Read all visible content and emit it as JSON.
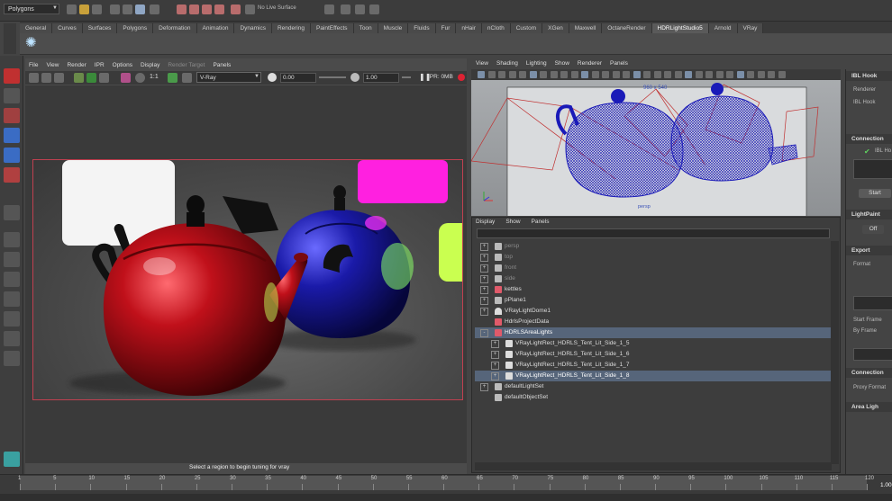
{
  "header": {
    "mode": "Polygons",
    "live_surface": "No Live Surface"
  },
  "shelf": {
    "tabs": [
      "General",
      "Curves",
      "Surfaces",
      "Polygons",
      "Deformation",
      "Animation",
      "Dynamics",
      "Rendering",
      "PaintEffects",
      "Toon",
      "Muscle",
      "Fluids",
      "Fur",
      "nHair",
      "nCloth",
      "Custom",
      "XGen",
      "Maxwell",
      "OctaneRender",
      "HDRLightStudio5",
      "Arnold",
      "VRay"
    ],
    "active_tab": "HDRLightStudio5"
  },
  "render_view": {
    "menu": [
      "File",
      "View",
      "Render",
      "IPR",
      "Options",
      "Display",
      "Render Target",
      "Panels"
    ],
    "renderer": "V-Ray",
    "exposure": "0.00",
    "gamma": "1.00",
    "ratio": "1:1",
    "ipr": "IPR: 0MB",
    "status": "Select a region to begin tuning for vray"
  },
  "viewport": {
    "menu": [
      "View",
      "Shading",
      "Lighting",
      "Show",
      "Renderer",
      "Panels"
    ],
    "resolution": "960 x 540",
    "camera": "persp"
  },
  "outliner": {
    "menu": [
      "Display",
      "Show",
      "Panels"
    ],
    "items": [
      {
        "label": "persp",
        "expand": "+",
        "depth": 0,
        "dim": true,
        "icon": "camera"
      },
      {
        "label": "top",
        "expand": "+",
        "depth": 0,
        "dim": true,
        "icon": "camera"
      },
      {
        "label": "front",
        "expand": "+",
        "depth": 0,
        "dim": true,
        "icon": "camera"
      },
      {
        "label": "side",
        "expand": "+",
        "depth": 0,
        "dim": true,
        "icon": "camera"
      },
      {
        "label": "kettles",
        "expand": "+",
        "depth": 0,
        "dim": false,
        "icon": "mesh"
      },
      {
        "label": "pPlane1",
        "expand": "+",
        "depth": 0,
        "dim": false,
        "icon": "plane"
      },
      {
        "label": "VRayLightDome1",
        "expand": "+",
        "depth": 0,
        "dim": false,
        "icon": "dome"
      },
      {
        "label": "HdrlsProjectData",
        "expand": "",
        "depth": 0,
        "dim": false,
        "icon": "mesh"
      },
      {
        "label": "HDRLSAreaLights",
        "expand": "-",
        "depth": 0,
        "dim": false,
        "icon": "mesh",
        "selected": true
      },
      {
        "label": "VRayLightRect_HDRLS_Tent_Lit_Side_1_5",
        "expand": "+",
        "depth": 1,
        "dim": false,
        "icon": "light"
      },
      {
        "label": "VRayLightRect_HDRLS_Tent_Lit_Side_1_6",
        "expand": "+",
        "depth": 1,
        "dim": false,
        "icon": "light"
      },
      {
        "label": "VRayLightRect_HDRLS_Tent_Lit_Side_1_7",
        "expand": "+",
        "depth": 1,
        "dim": false,
        "icon": "light"
      },
      {
        "label": "VRayLightRect_HDRLS_Tent_Lit_Side_1_8",
        "expand": "+",
        "depth": 1,
        "dim": false,
        "icon": "light",
        "selected": true
      },
      {
        "label": "defaultLightSet",
        "expand": "+",
        "depth": 0,
        "dim": false,
        "icon": "set"
      },
      {
        "label": "defaultObjectSet",
        "expand": "",
        "depth": 0,
        "dim": false,
        "icon": "set"
      }
    ]
  },
  "ibl_panel": {
    "title": "IBL Hook",
    "renderer_label": "Renderer",
    "hook_label": "IBL Hook",
    "connection_header": "Connection",
    "connection_item": "IBL Ho",
    "start_button": "Start",
    "lightpaint_header": "LightPaint",
    "off_button": "Off",
    "export_header": "Export",
    "format_label": "Format",
    "start_frame_label": "Start Frame",
    "by_frame_label": "By Frame",
    "connection2_header": "Connection",
    "proxy_format_label": "Proxy Format",
    "area_light_header": "Area Ligh"
  },
  "timeline": {
    "ticks": [
      "1",
      "5",
      "10",
      "15",
      "20",
      "25",
      "30",
      "35",
      "40",
      "45",
      "50",
      "55",
      "60",
      "65",
      "70",
      "75",
      "80",
      "85",
      "90",
      "95",
      "100",
      "105",
      "110",
      "115",
      "120"
    ],
    "current_frame": "1.00"
  },
  "colors": {
    "accent": "#5a6e86",
    "render_border": "#c04050",
    "wire": "#1a1ab8",
    "red_teapot": "#c0101a",
    "blue_teapot": "#1a1aa8"
  }
}
